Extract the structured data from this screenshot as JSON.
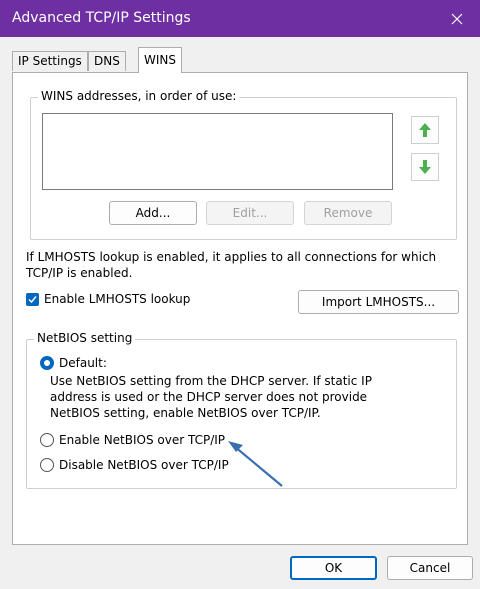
{
  "window": {
    "title": "Advanced TCP/IP Settings"
  },
  "tabs": [
    {
      "label": "IP Settings",
      "active": false
    },
    {
      "label": "DNS",
      "active": false
    },
    {
      "label": "WINS",
      "active": true
    }
  ],
  "wins": {
    "group_label": "WINS addresses, in order of use:",
    "addresses": [],
    "add_label": "Add...",
    "edit_label": "Edit...",
    "remove_label": "Remove"
  },
  "lmhosts": {
    "info": "If LMHOSTS lookup is enabled, it applies to all connections for which TCP/IP is enabled.",
    "checkbox_label": "Enable LMHOSTS lookup",
    "checked": true,
    "import_label": "Import LMHOSTS..."
  },
  "netbios": {
    "group_label": "NetBIOS setting",
    "default_label": "Default:",
    "default_desc": "Use NetBIOS setting from the DHCP server. If static IP address is used or the DHCP server does not provide NetBIOS setting, enable NetBIOS over TCP/IP.",
    "enable_label": "Enable NetBIOS over TCP/IP",
    "disable_label": "Disable NetBIOS over TCP/IP",
    "selected": "default"
  },
  "footer": {
    "ok_label": "OK",
    "cancel_label": "Cancel"
  },
  "colors": {
    "accent": "#0067c0",
    "titlebar": "#6e2fa3",
    "arrow_green": "#4caf50",
    "annotation": "#3a6fb0"
  }
}
